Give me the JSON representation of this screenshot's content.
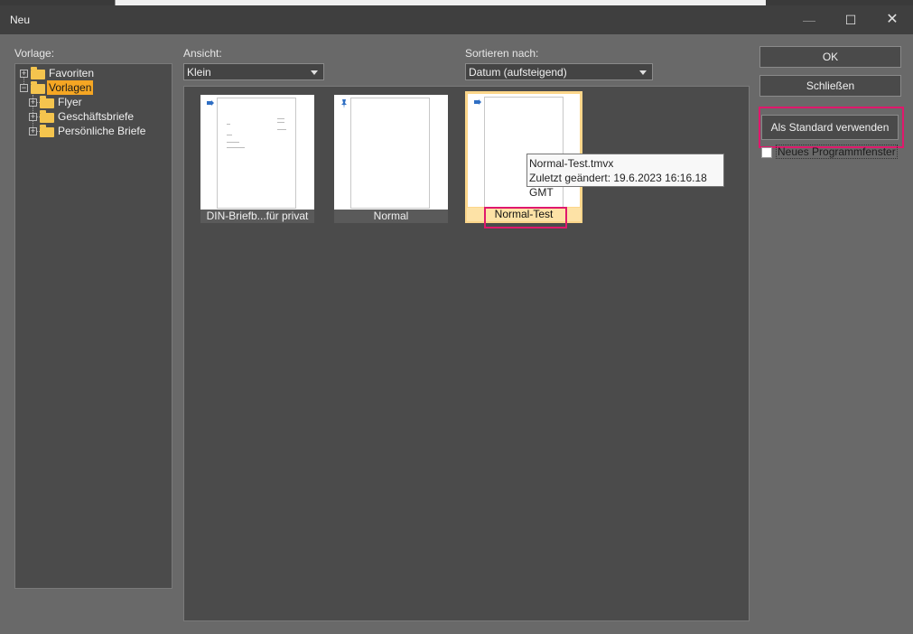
{
  "window": {
    "title": "Neu",
    "min_glyph": "—",
    "max_glyph": "☐",
    "close_glyph": "✕"
  },
  "labels": {
    "vorlage": "Vorlage:",
    "ansicht": "Ansicht:",
    "sortieren": "Sortieren nach:"
  },
  "tree": {
    "items": [
      {
        "label": "Favoriten",
        "expander": "+"
      },
      {
        "label": "Vorlagen",
        "expander": "−"
      },
      {
        "label": "Flyer",
        "expander": "+"
      },
      {
        "label": "Geschäftsbriefe",
        "expander": "+"
      },
      {
        "label": "Persönliche Briefe",
        "expander": "+"
      }
    ]
  },
  "view_combo": {
    "value": "Klein"
  },
  "sort_combo": {
    "value": "Datum (aufsteigend)"
  },
  "templates": [
    {
      "caption": "DIN-Briefb...für privat"
    },
    {
      "caption": "Normal"
    },
    {
      "caption": "Normal-Test"
    }
  ],
  "tooltip": {
    "line1": "Normal-Test.tmvx",
    "line2": "Zuletzt geändert: 19.6.2023 16:16.18 GMT"
  },
  "buttons": {
    "ok": "OK",
    "close": "Schließen",
    "default": "Als Standard verwenden"
  },
  "checkbox": {
    "label": "Neues Programmfenster",
    "checked": false
  },
  "colors": {
    "accent": "#f5a623",
    "highlight": "#e0186c",
    "selected_tile": "#fde2a6"
  }
}
